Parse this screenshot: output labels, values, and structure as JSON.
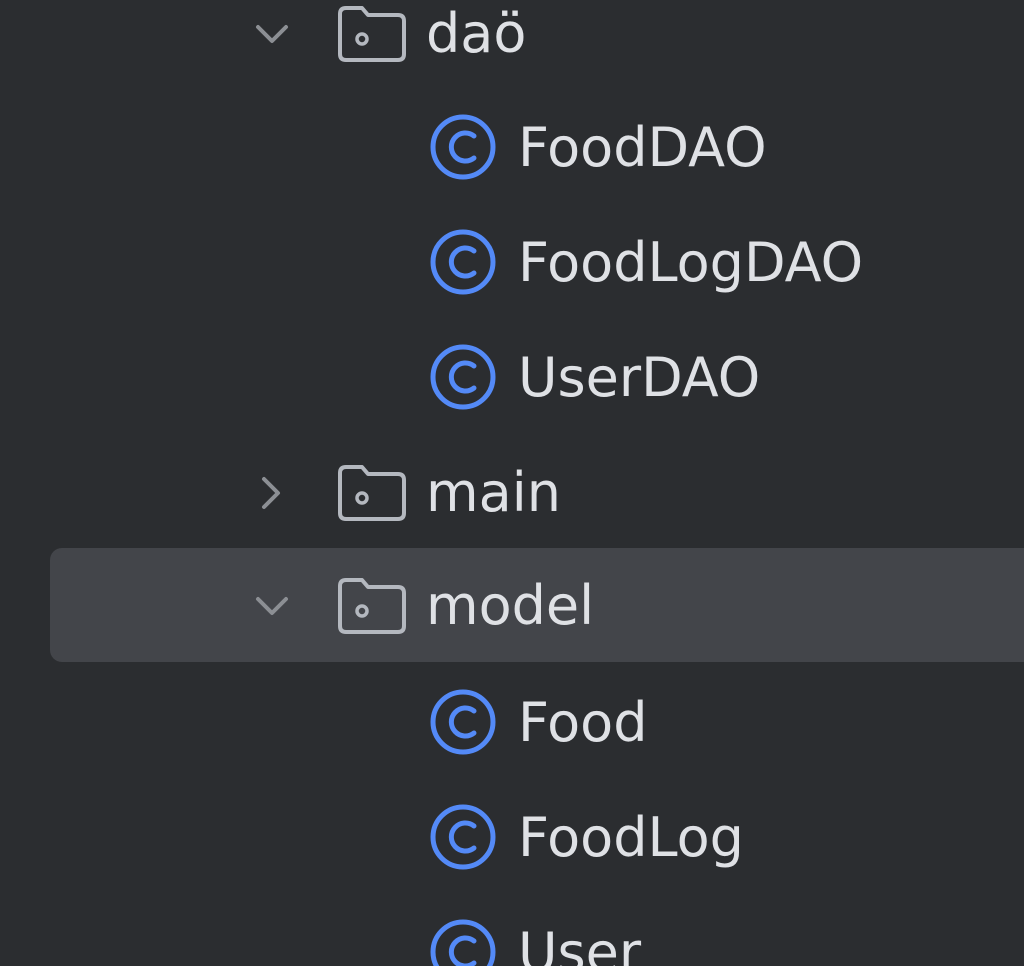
{
  "tree": {
    "items": [
      {
        "type": "folder",
        "label": "daö",
        "state": "expanded",
        "icon": "folder-package-icon"
      },
      {
        "type": "class",
        "label": "FoodDAO",
        "icon": "class-icon"
      },
      {
        "type": "class",
        "label": "FoodLogDAO",
        "icon": "class-icon"
      },
      {
        "type": "class",
        "label": "UserDAO",
        "icon": "class-icon"
      },
      {
        "type": "folder",
        "label": "main",
        "state": "collapsed",
        "icon": "folder-package-icon"
      },
      {
        "type": "folder",
        "label": "model",
        "state": "expanded",
        "selected": true,
        "icon": "folder-package-icon"
      },
      {
        "type": "class",
        "label": "Food",
        "icon": "class-icon"
      },
      {
        "type": "class",
        "label": "FoodLog",
        "icon": "class-icon"
      },
      {
        "type": "class",
        "label": "User",
        "icon": "class-icon"
      }
    ]
  },
  "colors": {
    "background": "#2b2d30",
    "selection": "#43454a",
    "text": "#dfe1e5",
    "folder_icon": "#b4b8bf",
    "class_icon": "#548af7"
  }
}
